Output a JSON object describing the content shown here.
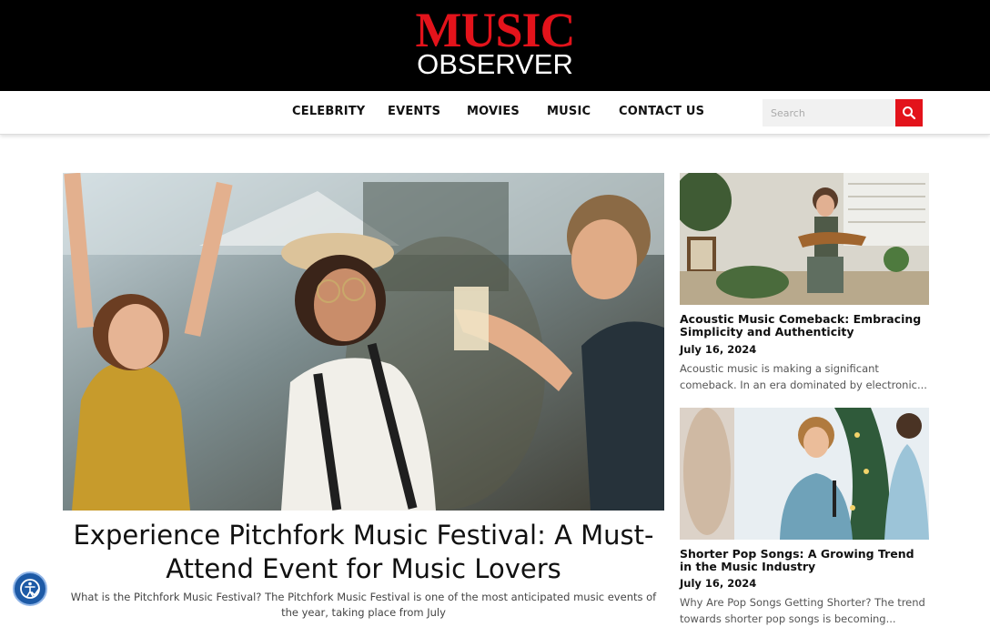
{
  "site": {
    "logo_line1": "MUSIC",
    "logo_line2": "OBSERVER",
    "brand_color": "#e3131b"
  },
  "nav": {
    "items": [
      "CELEBRITY",
      "EVENTS",
      "MOVIES",
      "MUSIC",
      "CONTACT US"
    ]
  },
  "search": {
    "placeholder": "Search",
    "value": "",
    "button_icon": "search-icon"
  },
  "hero": {
    "title": "Experience Pitchfork Music Festival: A Must-Attend Event for Music Lovers",
    "excerpt": "What is the Pitchfork Music Festival? The Pitchfork Music Festival is one of the most anticipated music events of the year, taking place from July"
  },
  "side_articles": [
    {
      "title": "Acoustic Music Comeback: Embracing Simplicity and Authenticity",
      "date": "July 16, 2024",
      "excerpt": "Acoustic music is making a significant comeback. In an era dominated by electronic..."
    },
    {
      "title": "Shorter Pop Songs: A Growing Trend in the Music Industry",
      "date": "July 16, 2024",
      "excerpt": "Why Are Pop Songs Getting Shorter? The trend towards shorter pop songs is becoming..."
    }
  ],
  "accessibility": {
    "icon": "accessibility-icon"
  }
}
